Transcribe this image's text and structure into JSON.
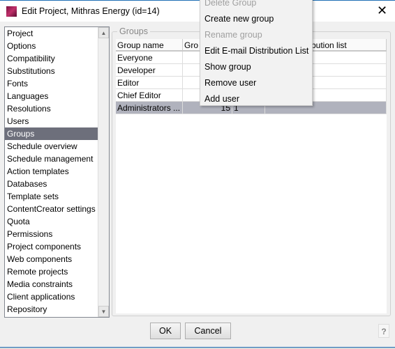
{
  "window": {
    "title": "Edit Project, Mithras Energy (id=14)",
    "close": "✕"
  },
  "nav": {
    "items": [
      "Project",
      "Options",
      "Compatibility",
      "Substitutions",
      "Fonts",
      "Languages",
      "Resolutions",
      "Users",
      "Groups",
      "Schedule overview",
      "Schedule management",
      "Action templates",
      "Databases",
      "Template sets",
      "ContentCreator settings",
      "Quota",
      "Permissions",
      "Project components",
      "Web components",
      "Remote projects",
      "Media constraints",
      "Client applications",
      "Repository"
    ],
    "selected": "Groups"
  },
  "groups": {
    "label": "Groups",
    "columns": [
      "Group name",
      "Gro",
      "",
      "bution list"
    ],
    "rows": [
      [
        "Everyone",
        "",
        "",
        ""
      ],
      [
        "Developer",
        "",
        "",
        ""
      ],
      [
        "Editor",
        "",
        "",
        ""
      ],
      [
        "Chief Editor",
        "",
        "",
        ""
      ],
      [
        "Administrators ...",
        "15",
        "1",
        ""
      ]
    ],
    "selected_row": 4
  },
  "context_menu": {
    "items": [
      {
        "label": "Delete Group",
        "disabled": true
      },
      {
        "label": "Create new group",
        "disabled": false
      },
      {
        "label": "Rename group",
        "disabled": true
      },
      {
        "label": "Edit E-mail Distribution List",
        "disabled": false
      },
      {
        "label": "Show group",
        "disabled": false
      },
      {
        "label": "Remove user",
        "disabled": false
      },
      {
        "label": "Add user",
        "disabled": false
      }
    ]
  },
  "buttons": {
    "ok": "OK",
    "cancel": "Cancel",
    "help": "?"
  }
}
